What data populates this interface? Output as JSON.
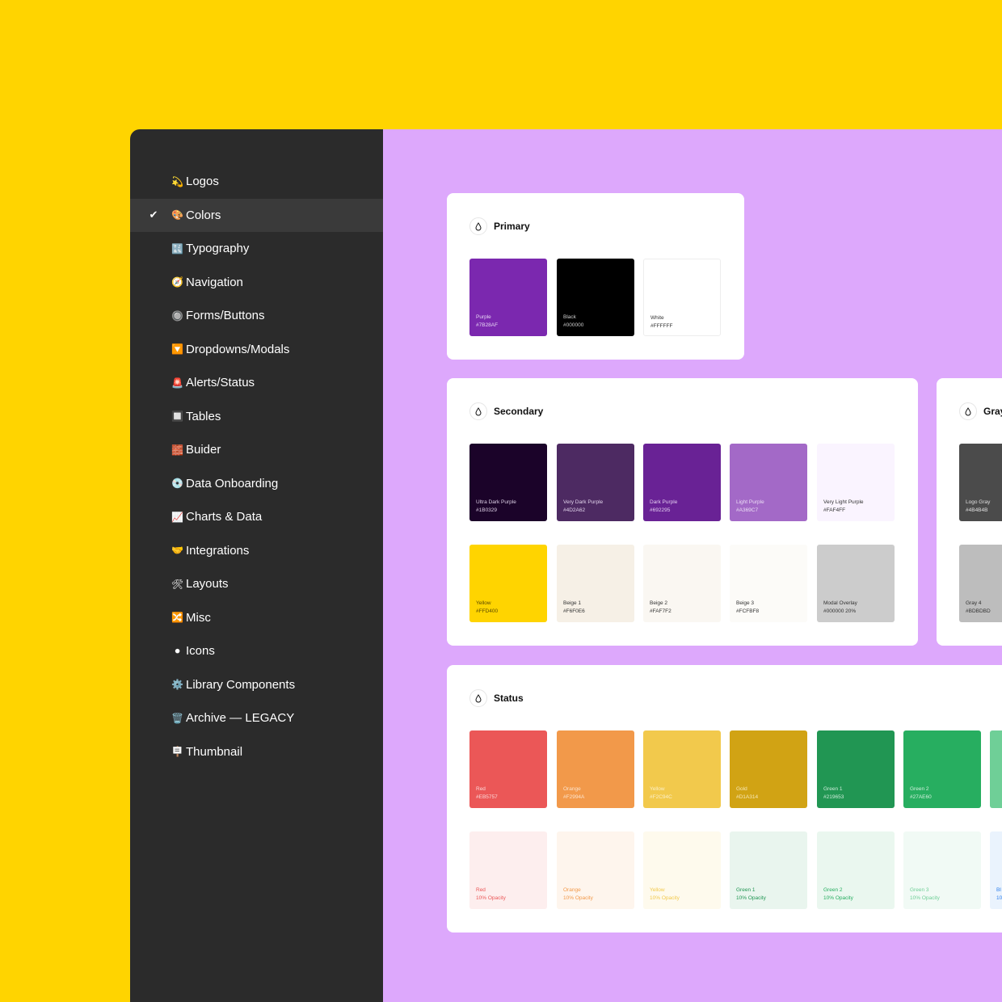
{
  "sidebar": {
    "items": [
      {
        "emoji": "💫",
        "label": "Logos",
        "active": false
      },
      {
        "emoji": "🎨",
        "label": "Colors",
        "active": true
      },
      {
        "emoji": "🔣",
        "label": "Typography",
        "active": false
      },
      {
        "emoji": "🧭",
        "label": "Navigation",
        "active": false
      },
      {
        "emoji": "🔘",
        "label": "Forms/Buttons",
        "active": false
      },
      {
        "emoji": "🔽",
        "label": "Dropdowns/Modals",
        "active": false
      },
      {
        "emoji": "🚨",
        "label": "Alerts/Status",
        "active": false
      },
      {
        "emoji": "🔲",
        "label": "Tables",
        "active": false
      },
      {
        "emoji": "🧱",
        "label": "Buider",
        "active": false
      },
      {
        "emoji": "💿",
        "label": "Data Onboarding",
        "active": false
      },
      {
        "emoji": "📈",
        "label": "Charts & Data",
        "active": false
      },
      {
        "emoji": "🤝",
        "label": "Integrations",
        "active": false
      },
      {
        "emoji": "🛠",
        "label": "Layouts",
        "active": false
      },
      {
        "emoji": "🔀",
        "label": "Misc",
        "active": false
      },
      {
        "emoji": "⚫",
        "label": "Icons",
        "active": false
      },
      {
        "emoji": "⚙️",
        "label": "Library Components",
        "active": false
      },
      {
        "emoji": "🗑️",
        "label": "Archive — LEGACY",
        "active": false
      },
      {
        "emoji": "🪧",
        "label": "Thumbnail",
        "active": false
      }
    ],
    "check_glyph": "✔"
  },
  "cards": {
    "primary": {
      "title": "Primary",
      "swatches": [
        {
          "name": "Purple",
          "hex": "#7B28AF",
          "color": "#7B28AF",
          "text": "#E6D4F3"
        },
        {
          "name": "Black",
          "hex": "#000000",
          "color": "#000000",
          "text": "#CCCCCC"
        },
        {
          "name": "White",
          "hex": "#FFFFFF",
          "color": "#FFFFFF",
          "text": "#333333",
          "border": "#EDEDED"
        }
      ]
    },
    "secondary": {
      "title": "Secondary",
      "swatches": [
        {
          "name": "Ultra Dark Purple",
          "hex": "#1B0329",
          "color": "#1B0329",
          "text": "#DDD0E6"
        },
        {
          "name": "Very Dark Purple",
          "hex": "#4D2A62",
          "color": "#4D2A62",
          "text": "#E0D2EA"
        },
        {
          "name": "Dark Purple",
          "hex": "#692295",
          "color": "#692295",
          "text": "#E2CCF0"
        },
        {
          "name": "Light Purple",
          "hex": "#A369C7",
          "color": "#A369C7",
          "text": "#EBDDF5"
        },
        {
          "name": "Very Light Purple",
          "hex": "#FAF4FF",
          "color": "#FAF4FF",
          "text": "#333333"
        },
        {
          "name": "Yellow",
          "hex": "#FFD400",
          "color": "#FFD400",
          "text": "#5A4A00"
        },
        {
          "name": "Beige 1",
          "hex": "#F6F0E6",
          "color": "#F6F0E6",
          "text": "#333333"
        },
        {
          "name": "Beige 2",
          "hex": "#FAF7F2",
          "color": "#FAF7F2",
          "text": "#333333"
        },
        {
          "name": "Beige 3",
          "hex": "#FCFBF8",
          "color": "#FCFBF8",
          "text": "#333333"
        },
        {
          "name": "Modal Overlay",
          "hex": "#000000 20%",
          "color": "#CCCCCC",
          "text": "#333333"
        }
      ]
    },
    "gray": {
      "title": "Gray",
      "swatches": [
        {
          "name": "Logo Gray",
          "hex": "#4B4B4B",
          "color": "#4B4B4B",
          "text": "#E0E0E0"
        },
        {
          "name": "Gray 4",
          "hex": "#BDBDBD",
          "color": "#BDBDBD",
          "text": "#333333"
        }
      ]
    },
    "status": {
      "title": "Status",
      "swatches": [
        {
          "name": "Red",
          "hex": "#EB5757",
          "color": "#EB5757",
          "text": "#FBD9D9"
        },
        {
          "name": "Orange",
          "hex": "#F2994A",
          "color": "#F2994A",
          "text": "#FCE3CC"
        },
        {
          "name": "Yellow",
          "hex": "#F2C94C",
          "color": "#F2C94C",
          "text": "#FBEFC7"
        },
        {
          "name": "Gold",
          "hex": "#D1A314",
          "color": "#D1A314",
          "text": "#F6E8B8"
        },
        {
          "name": "Green 1",
          "hex": "#219653",
          "color": "#219653",
          "text": "#CDEBD9"
        },
        {
          "name": "Green 2",
          "hex": "#27AE60",
          "color": "#27AE60",
          "text": "#D2F0DE"
        },
        {
          "name": "",
          "hex": "",
          "color": "#6FCF97",
          "text": "#DDF5E6"
        },
        {
          "name": "Red",
          "hex": "10% Opacity",
          "color": "#FDEEEE",
          "text": "#EB5757"
        },
        {
          "name": "Orange",
          "hex": "10% Opacity",
          "color": "#FEF5ED",
          "text": "#F2994A"
        },
        {
          "name": "Yellow",
          "hex": "10% Opacity",
          "color": "#FEFAED",
          "text": "#F2C94C"
        },
        {
          "name": "Green 1",
          "hex": "10% Opacity",
          "color": "#E9F5EE",
          "text": "#219653"
        },
        {
          "name": "Green 2",
          "hex": "10% Opacity",
          "color": "#EAF7EF",
          "text": "#27AE60"
        },
        {
          "name": "Green 3",
          "hex": "10% Opacity",
          "color": "#F1FAF5",
          "text": "#6FCF97"
        },
        {
          "name": "Bl",
          "hex": "10",
          "color": "#EAF3FD",
          "text": "#2F80ED"
        }
      ]
    }
  }
}
